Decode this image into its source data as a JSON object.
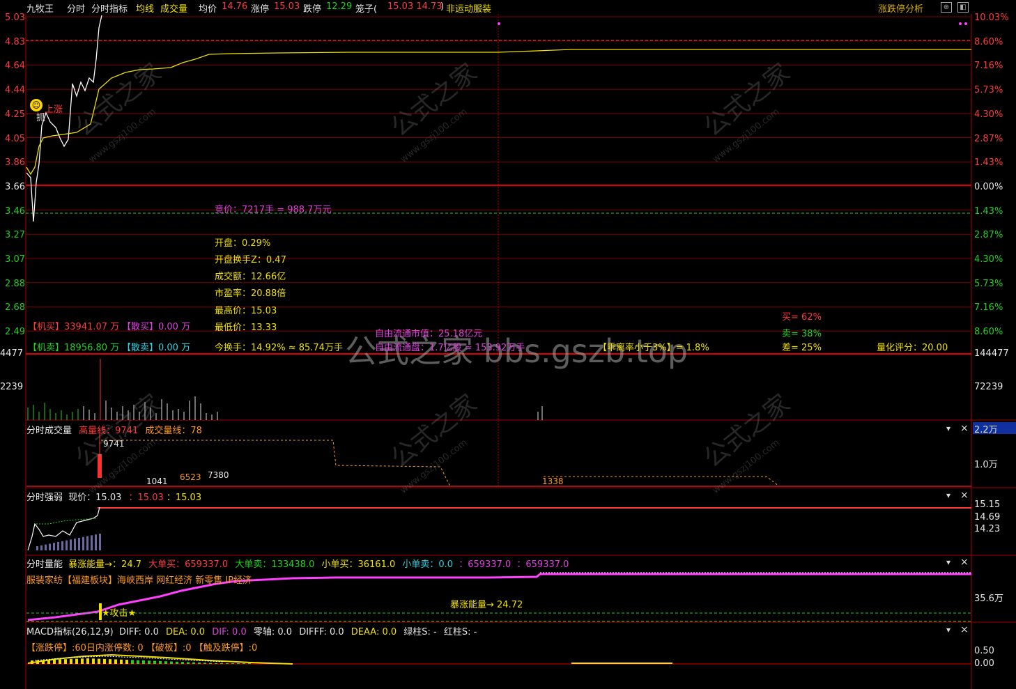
{
  "header": {
    "stock_name": "九牧王",
    "tabs": [
      "分时",
      "分时指标",
      "均线",
      "成交量"
    ],
    "avg_label": "均价",
    "avg_value": "14.76",
    "limit_up_label": "涨停",
    "limit_up_value": "15.03",
    "limit_down_label": "跌停",
    "limit_down_value": "12.29",
    "cage_label": "笼子(",
    "cage_values": "15.03 14.73",
    "cage_close": ")",
    "sector": "非运动服装",
    "right_label": "涨跌停分析"
  },
  "price_axis": {
    "left": [
      "5.03",
      "4.83",
      "4.64",
      "4.44",
      "4.25",
      "4.05",
      "3.86",
      "3.66",
      "3.46",
      "3.27",
      "3.07",
      "2.88",
      "2.68",
      "2.49"
    ],
    "right": [
      "10.03%",
      "8.60%",
      "7.16%",
      "5.73%",
      "4.30%",
      "2.87%",
      "1.43%",
      "0.00%",
      "1.43%",
      "2.87%",
      "4.30%",
      "5.73%",
      "7.16%",
      "8.60%"
    ],
    "vol_left": [
      "4477",
      "2239"
    ],
    "vol_right": [
      "144477",
      "72239"
    ]
  },
  "markers": {
    "catch_label": "抓",
    "up_label": "上涨"
  },
  "info": {
    "auction": "竞价：7217手 = 988.7万元",
    "open": "开盘：0.29%",
    "open_turnover": "开盘换手Z：0.47",
    "amount": "成交额：12.66亿",
    "pe": "市盈率：20.88倍",
    "high": "最高价：15.03",
    "low": "最低价：13.33",
    "turnover": "今换手：14.92% ≈ 85.74万手",
    "float_cap": "自由流通市值：25.18亿元",
    "float_shares": "自由流通盘：1.7亿股 ≈ 153.92万手",
    "jimai": "【机买】33941.07 万",
    "sanmai": "【散买】0.00 万",
    "jimai2": "【机卖】18956.80 万",
    "sanmai2": "【散卖】0.00 万",
    "deviation": "【乖离率小于3%】= 1.8%",
    "buy": "买= 62%",
    "sell": "卖= 38%",
    "diff": "差= 25%",
    "score": "量化评分：20.00"
  },
  "watermark": {
    "main": "公式之家 bbs.gszb.top",
    "cn": "公式之家",
    "url": "www.gszj100.com"
  },
  "panel_vol": {
    "title": "分时成交量",
    "hl_label": "高量线：9741",
    "vl_label": "成交量线：78",
    "peak_label": "9741",
    "label_a": "6523",
    "label_b": "7380",
    "label_c": "1041",
    "label_d": "1338",
    "right_top": "2.2万",
    "right_mid": "1.0万"
  },
  "panel_strength": {
    "title": "分时强弱",
    "price_label": "现价：15.03",
    "v2": "：15.03",
    "v3": "：15.03",
    "r1": "15.15",
    "r2": "14.69",
    "r3": "14.23"
  },
  "panel_energy": {
    "title": "分时量能",
    "surge": "暴涨能量→：24.7",
    "big_buy": "大单买：659337.0",
    "big_sell": "大单卖：133438.0",
    "small_buy": "小单买：36161.0",
    "small_sell": "小单卖：0.0",
    "v1": "：659337.0",
    "v2": "：659337.0",
    "concepts": "服装家纺【福建板块】海峡西岸 网红经济 新零售 IP经济",
    "surge_mid": "暴涨能量→ 24.72",
    "attack": "★攻击★",
    "right": "35.6万"
  },
  "panel_macd": {
    "title": "MACD指标(26,12,9)",
    "diff": "DIFF: 0.0",
    "dea": "DEA: 0.0",
    "dif": "DIF: 0.0",
    "zero": "零轴: 0.0",
    "difff": "DIFFF: 0.0",
    "deaa": "DEAA: 0.0",
    "green": "绿柱S: -",
    "red": "红柱S: -",
    "limit_line": "【涨跌停】:60日内涨停数: 0 【破板】:0 【触及跌停】:0",
    "r1": "0.50",
    "r2": "0.00"
  },
  "controls": {
    "down": "▾",
    "close": "×"
  },
  "colors": {
    "bg": "#000000",
    "grid": "#8a0000",
    "price": "#ffffff",
    "avg": "#f0e000",
    "accent": "#ff3b3b"
  }
}
